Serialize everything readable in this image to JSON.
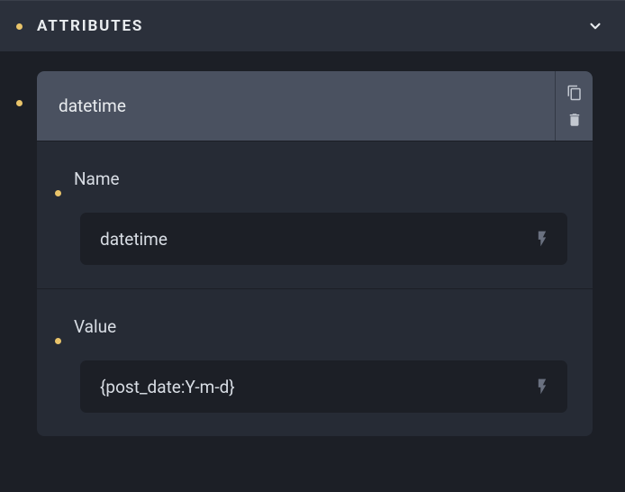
{
  "panel": {
    "title": "ATTRIBUTES"
  },
  "attribute": {
    "header": "datetime",
    "fields": {
      "name": {
        "label": "Name",
        "value": "datetime"
      },
      "value": {
        "label": "Value",
        "value": "{post_date:Y-m-d}"
      }
    }
  }
}
